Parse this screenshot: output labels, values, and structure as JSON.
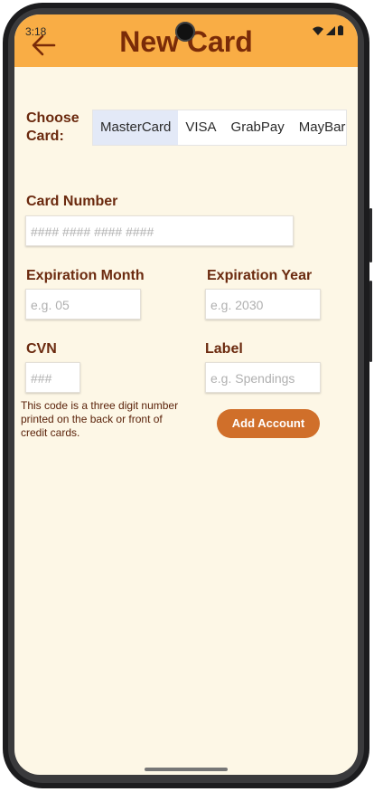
{
  "status_bar": {
    "time": "3:18"
  },
  "header": {
    "title": "New Card"
  },
  "form": {
    "choose_card_label": "Choose\nCard:",
    "card_options": [
      "MasterCard",
      "VISA",
      "GrabPay",
      "MayBar"
    ],
    "selected_card": "MasterCard",
    "card_number_label": "Card Number",
    "card_number_placeholder": "#### #### #### ####",
    "exp_month_label": "Expiration Month",
    "exp_month_placeholder": "e.g. 05",
    "exp_year_label": "Expiration Year",
    "exp_year_placeholder": "e.g. 2030",
    "cvn_label": "CVN",
    "cvn_placeholder": "###",
    "label_label": "Label",
    "label_placeholder": "e.g. Spendings",
    "cvn_helper": "This code is a three digit number printed on the back or front of credit cards.",
    "add_button": "Add Account"
  },
  "colors": {
    "appbar": "#f9ad45",
    "title": "#7a2b08",
    "background": "#fdf7e6",
    "button": "#d06f2a"
  }
}
